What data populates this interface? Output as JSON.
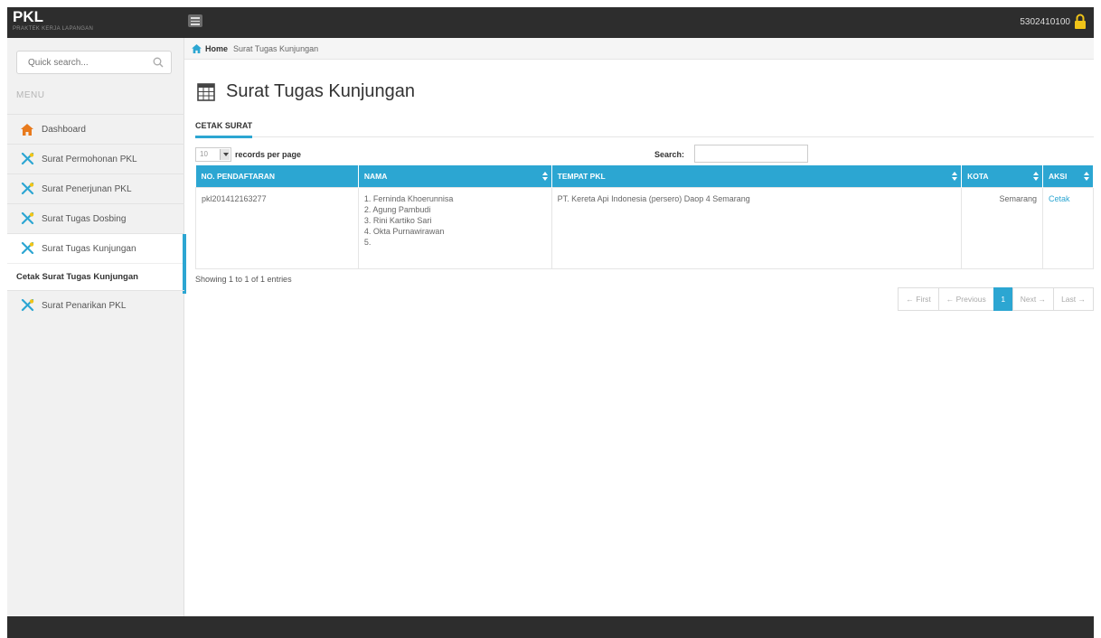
{
  "brand": {
    "title": "PKL",
    "subtitle": "Praktek Kerja Lapangan"
  },
  "topbar": {
    "user_id": "5302410100"
  },
  "sidebar": {
    "search_placeholder": "Quick search...",
    "menu_label": "MENU",
    "items": [
      {
        "label": "Dashboard",
        "icon": "home-icon"
      },
      {
        "label": "Surat Permohonan PKL",
        "icon": "tools-icon"
      },
      {
        "label": "Surat Penerjunan PKL",
        "icon": "tools-icon"
      },
      {
        "label": "Surat Tugas Dosbing",
        "icon": "tools-icon"
      },
      {
        "label": "Surat Tugas Kunjungan",
        "icon": "tools-icon"
      },
      {
        "label": "Surat Penarikan PKL",
        "icon": "tools-icon"
      }
    ],
    "sub_item": "Cetak Surat Tugas Kunjungan"
  },
  "breadcrumb": {
    "home": "Home",
    "current": "Surat Tugas Kunjungan"
  },
  "page": {
    "title": "Surat Tugas Kunjungan",
    "tab": "CETAK SURAT"
  },
  "table": {
    "length_value": "10",
    "length_label": "records per page",
    "search_label": "Search:",
    "columns": [
      "NO. PENDAFTARAN",
      "NAMA",
      "TEMPAT PKL",
      "KOTA",
      "AKSI"
    ],
    "rows": [
      {
        "no": "pkl201412163277",
        "nama": [
          "1. Ferninda Khoerunnisa",
          "2. Agung Pambudi",
          "3. Rini Kartiko Sari",
          "4. Okta Purnawirawan",
          "5."
        ],
        "tempat": "PT. Kereta Api Indonesia (persero) Daop 4 Semarang",
        "kota": "Semarang",
        "aksi": "Cetak"
      }
    ],
    "info": "Showing 1 to 1 of 1 entries"
  },
  "pagination": {
    "first": "← First",
    "previous": "← Previous",
    "current": "1",
    "next": "Next →",
    "last": "Last →"
  },
  "colors": {
    "accent": "#2ca6d2",
    "topbar": "#2d2d2d",
    "lock": "#f0c419",
    "home": "#e87a1d",
    "tools": "#2ca6d2"
  }
}
